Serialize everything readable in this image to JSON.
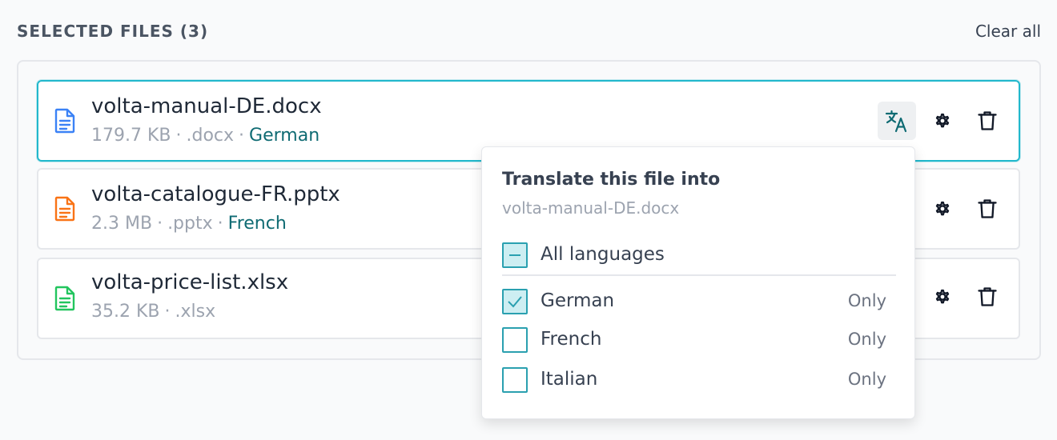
{
  "header": {
    "title": "SELECTED FILES (3)",
    "clear_all": "Clear all"
  },
  "files": [
    {
      "name": "volta-manual-DE.docx",
      "size": "179.7 KB",
      "ext": ".docx",
      "language": "German",
      "icon": "document-icon",
      "icon_color": "#3b82f6"
    },
    {
      "name": "volta-catalogue-FR.pptx",
      "size": "2.3 MB",
      "ext": ".pptx",
      "language": "French",
      "icon": "document-icon",
      "icon_color": "#f97316"
    },
    {
      "name": "volta-price-list.xlsx",
      "size": "35.2 KB",
      "ext": ".xlsx",
      "language": "",
      "icon": "document-icon",
      "icon_color": "#22c55e"
    }
  ],
  "separator": "·",
  "popover": {
    "title": "Translate this file into",
    "subtitle": "volta-manual-DE.docx",
    "all_label": "All languages",
    "all_state": "indeterminate",
    "options": [
      {
        "label": "German",
        "checked": true,
        "only": "Only"
      },
      {
        "label": "French",
        "checked": false,
        "only": "Only"
      },
      {
        "label": "Italian",
        "checked": false,
        "only": "Only"
      }
    ]
  },
  "colors": {
    "accent": "#22b8cc",
    "accent_dark": "#0f6b73"
  }
}
